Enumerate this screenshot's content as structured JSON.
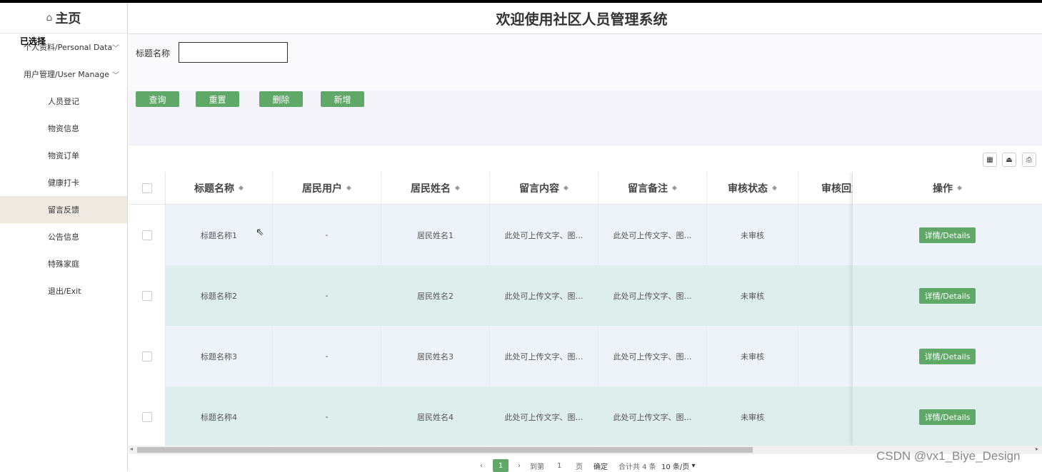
{
  "sidebar": {
    "home_icon": "⌂",
    "home_label": "主页",
    "overlay_label": "已选择",
    "groups": [
      {
        "label": "个人资料/Personal Data"
      },
      {
        "label": "用户管理/User Manage"
      }
    ],
    "items": [
      {
        "label": "人员登记"
      },
      {
        "label": "物资信息"
      },
      {
        "label": "物资订单"
      },
      {
        "label": "健康打卡"
      },
      {
        "label": "留言反馈"
      },
      {
        "label": "公告信息"
      },
      {
        "label": "特殊家庭"
      },
      {
        "label": "退出/Exit"
      }
    ],
    "active_item": "留言反馈"
  },
  "header": {
    "title": "欢迎使用社区人员管理系统"
  },
  "search": {
    "label": "标题名称",
    "value": ""
  },
  "buttons": {
    "query": "查询",
    "reset": "重置",
    "delete": "删除",
    "add": "新增"
  },
  "table": {
    "columns": [
      "标题名称",
      "居民用户",
      "居民姓名",
      "留言内容",
      "留言备注",
      "审核状态",
      "审核回复",
      "操作"
    ],
    "rows": [
      {
        "title": "标题名称1",
        "user": "-",
        "name": "居民姓名1",
        "content": "此处可上传文字、图…",
        "note": "此处可上传文字、图…",
        "status": "未审核",
        "reply": "",
        "action": "详情/Details"
      },
      {
        "title": "标题名称2",
        "user": "-",
        "name": "居民姓名2",
        "content": "此处可上传文字、图…",
        "note": "此处可上传文字、图…",
        "status": "未审核",
        "reply": "",
        "action": "详情/Details"
      },
      {
        "title": "标题名称3",
        "user": "-",
        "name": "居民姓名3",
        "content": "此处可上传文字、图…",
        "note": "此处可上传文字、图…",
        "status": "未审核",
        "reply": "",
        "action": "详情/Details"
      },
      {
        "title": "标题名称4",
        "user": "-",
        "name": "居民姓名4",
        "content": "此处可上传文字、图…",
        "note": "此处可上传文字、图…",
        "status": "未审核",
        "reply": "",
        "action": "详情/Details"
      }
    ]
  },
  "pager": {
    "prev": "‹",
    "current": "1",
    "next": "›",
    "goto": "到第",
    "page_input": "1",
    "page_unit": "页",
    "confirm": "确定",
    "total": "合计共 4 条",
    "page_size": "10 条/页"
  },
  "watermark": "CSDN @vx1_Biye_Design",
  "colors": {
    "accent": "#5fa868",
    "row_odd": "#eef3fa",
    "row_even": "#ddeeed",
    "active_menu": "#efe9e2"
  }
}
